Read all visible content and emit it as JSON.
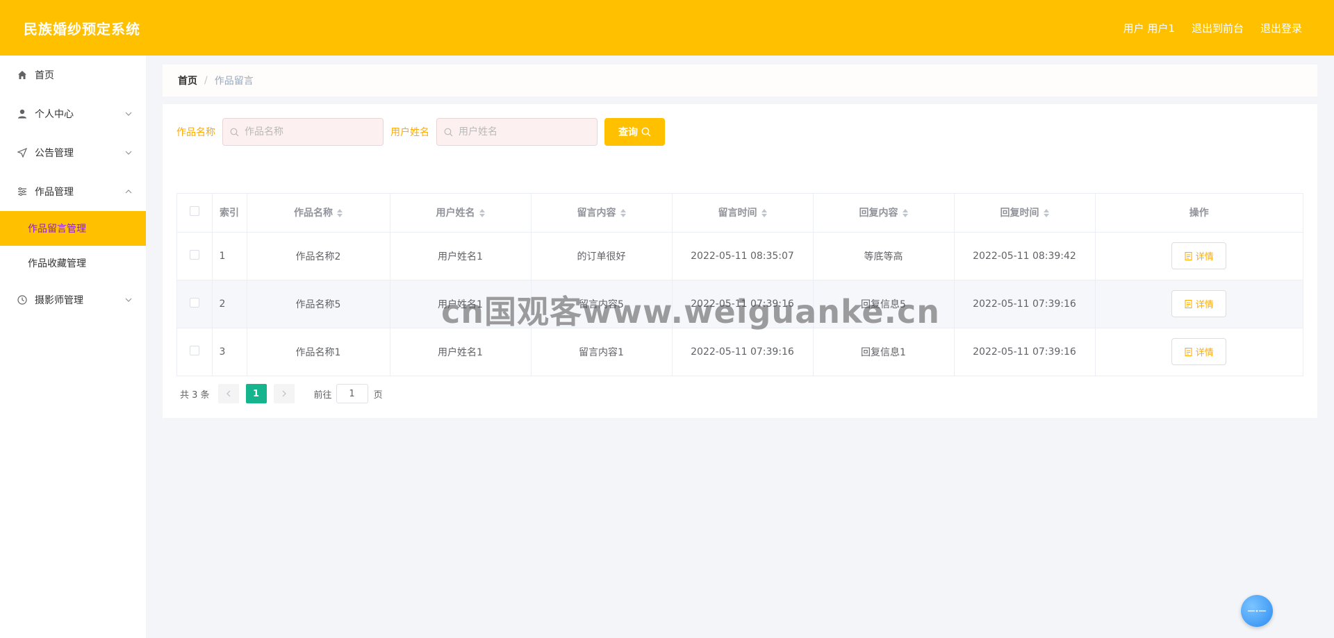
{
  "header": {
    "brand": "民族婚纱预定系统",
    "user_label": "用户 用户1",
    "to_front": "退出到前台",
    "logout": "退出登录"
  },
  "sidebar": {
    "items": [
      {
        "label": "首页",
        "icon": "home-icon"
      },
      {
        "label": "个人中心",
        "icon": "user-icon"
      },
      {
        "label": "公告管理",
        "icon": "send-icon"
      },
      {
        "label": "作品管理",
        "icon": "sliders-icon"
      },
      {
        "label": "摄影师管理",
        "icon": "clock-icon"
      }
    ],
    "submenu": [
      {
        "label": "作品留言管理",
        "active": true
      },
      {
        "label": "作品收藏管理",
        "active": false
      }
    ]
  },
  "breadcrumb": {
    "home": "首页",
    "separator": "/",
    "current": "作品留言"
  },
  "search": {
    "work_label": "作品名称",
    "work_placeholder": "作品名称",
    "user_label": "用户姓名",
    "user_placeholder": "用户姓名",
    "query_button": "查询"
  },
  "table": {
    "headers": {
      "index": "索引",
      "work_name": "作品名称",
      "user_name": "用户姓名",
      "content": "留言内容",
      "time": "留言时间",
      "reply": "回复内容",
      "reply_time": "回复时间",
      "action": "操作"
    },
    "rows": [
      {
        "index": "1",
        "work_name": "作品名称2",
        "user_name": "用户姓名1",
        "content": "的订单很好",
        "time": "2022-05-11 08:35:07",
        "reply": "等底等高",
        "reply_time": "2022-05-11 08:39:42",
        "action": "详情"
      },
      {
        "index": "2",
        "work_name": "作品名称5",
        "user_name": "用户姓名1",
        "content": "留言内容5",
        "time": "2022-05-11 07:39:16",
        "reply": "回复信息5",
        "reply_time": "2022-05-11 07:39:16",
        "action": "详情"
      },
      {
        "index": "3",
        "work_name": "作品名称1",
        "user_name": "用户姓名1",
        "content": "留言内容1",
        "time": "2022-05-11 07:39:16",
        "reply": "回复信息1",
        "reply_time": "2022-05-11 07:39:16",
        "action": "详情"
      }
    ]
  },
  "pagination": {
    "total": "共 3 条",
    "current_page": "1",
    "goto_label": "前往",
    "goto_value": "1",
    "page_suffix": "页"
  },
  "watermark": "cn国观客www.weiguanke.cn",
  "colors": {
    "accent": "#ffc000",
    "active_text": "#8c1bd6",
    "page_active": "#16b48c"
  }
}
